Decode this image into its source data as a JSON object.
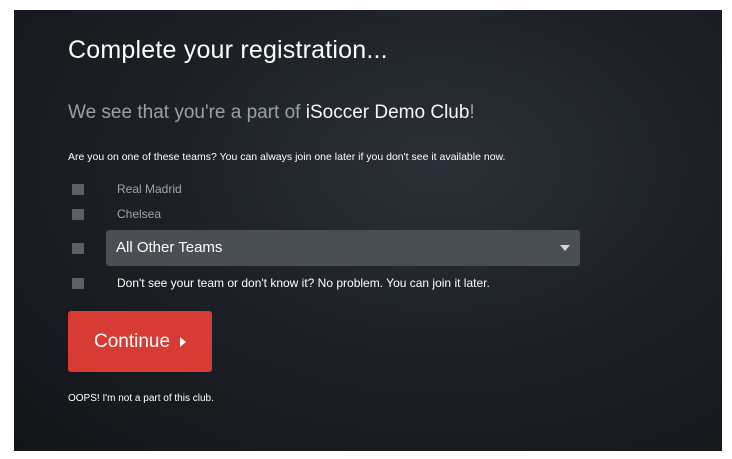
{
  "form": {
    "title": "Complete your registration...",
    "subtitle_prefix": "We see that you're a part of ",
    "club_name": "iSoccer Demo Club",
    "subtitle_suffix": "!",
    "question": "Are you on one of these teams? You can always join one later if you don't see it available now.",
    "teams": [
      {
        "label": "Real Madrid",
        "checked": false
      },
      {
        "label": "Chelsea",
        "checked": false
      }
    ],
    "other_teams_select": {
      "selected": "All Other Teams",
      "checked": false
    },
    "no_team_note": "Don't see your team or don't know it? No problem. You can join it later.",
    "continue_label": "Continue",
    "oops_link": "OOPS! I'm not a part of this club."
  },
  "colors": {
    "panel_bg": "#1d2127",
    "accent_button": "#d83b34",
    "muted_text": "#9aa0a8",
    "checkbox": "#5c6168",
    "select_bg": "#4a4f56"
  },
  "icons": {
    "select_arrow": "chevron-down-icon",
    "continue_arrow": "caret-right-icon"
  }
}
